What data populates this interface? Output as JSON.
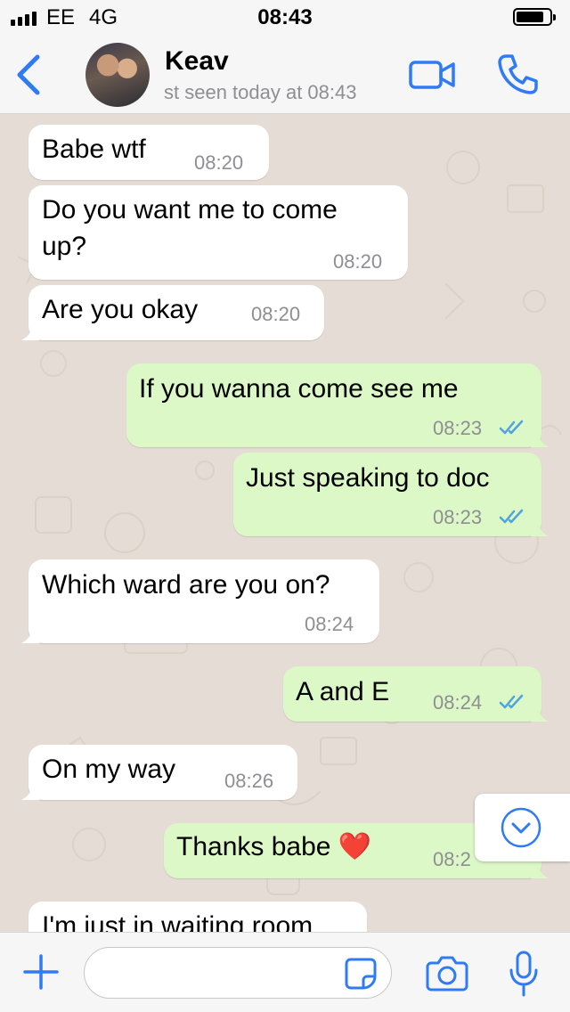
{
  "status_bar": {
    "carrier": "EE",
    "network": "4G",
    "time": "08:43"
  },
  "header": {
    "contact_name": "Keav",
    "last_seen": "st seen today at 08:43"
  },
  "messages": [
    {
      "direction": "in",
      "text": "Babe wtf",
      "time": "08:20"
    },
    {
      "direction": "in",
      "text": "Do you want me to come",
      "text2": "up?",
      "time": "08:20"
    },
    {
      "direction": "in",
      "text": "Are you okay",
      "time": "08:20"
    },
    {
      "direction": "out",
      "text": "If you wanna come see me",
      "time": "08:23",
      "status": "read"
    },
    {
      "direction": "out",
      "text": "Just speaking to doc",
      "time": "08:23",
      "status": "read"
    },
    {
      "direction": "in",
      "text": "Which ward are you on?",
      "time": "08:24"
    },
    {
      "direction": "out",
      "text": "A and E",
      "time": "08:24",
      "status": "read"
    },
    {
      "direction": "in",
      "text": "On my way",
      "time": "08:26"
    },
    {
      "direction": "out",
      "text": "Thanks babe ❤️",
      "time": "08:2"
    },
    {
      "direction": "in",
      "text": "I'm just in waiting room"
    }
  ],
  "input": {
    "placeholder": ""
  },
  "icons": {
    "back": "chevron-left-icon",
    "video": "video-camera-icon",
    "call": "phone-icon",
    "scroll": "chevron-down-circle-icon",
    "attach": "plus-icon",
    "sticker": "sticker-icon",
    "camera": "camera-icon",
    "mic": "microphone-icon"
  },
  "colors": {
    "accent": "#2f7bf6",
    "incoming": "#ffffff",
    "outgoing": "#dcf8c6",
    "read_ticks": "#4fa3e0",
    "wallpaper": "#e5ddd5"
  }
}
